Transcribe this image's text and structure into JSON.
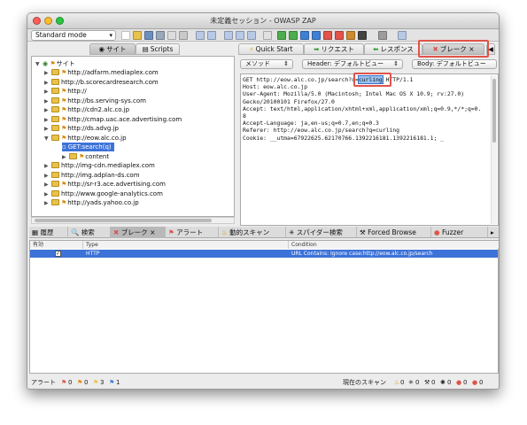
{
  "window": {
    "title": "未定義セッション - OWASP ZAP"
  },
  "toolbar": {
    "mode": "Standard mode"
  },
  "sites_tabs": [
    {
      "label": "サイト",
      "icon": "globe-icon"
    },
    {
      "label": "Scripts",
      "icon": "script-icon"
    }
  ],
  "tree": {
    "root": "サイト",
    "items": [
      {
        "label": "http://adfarm.mediaplex.com",
        "flag": true,
        "expanded": false
      },
      {
        "label": "http://b.scorecardresearch.com",
        "flag": false,
        "expanded": false
      },
      {
        "label": "http://",
        "flag": true,
        "expanded": false
      },
      {
        "label": "http://bs.serving-sys.com",
        "flag": true,
        "expanded": false
      },
      {
        "label": "http://cdn2.alc.co.jp",
        "flag": true,
        "expanded": false
      },
      {
        "label": "http://cmap.uac.ace.advertising.com",
        "flag": true,
        "expanded": false
      },
      {
        "label": "http://ds.advg.jp",
        "flag": true,
        "expanded": false
      },
      {
        "label": "http://eow.alc.co.jp",
        "flag": true,
        "expanded": true
      },
      {
        "label": "GET:search(q)",
        "child": true,
        "selected": true
      },
      {
        "label": "content",
        "child": true,
        "folder": true,
        "flag": true
      },
      {
        "label": "http://img-cdn.mediaplex.com",
        "flag": false,
        "expanded": false
      },
      {
        "label": "http://img.adplan-ds.com",
        "flag": false,
        "expanded": false
      },
      {
        "label": "http://sr-r3.ace.advertising.com",
        "flag": true,
        "expanded": false
      },
      {
        "label": "http://www.google-analytics.com",
        "flag": false,
        "expanded": false
      },
      {
        "label": "http://yads.yahoo.co.jp",
        "flag": true,
        "expanded": false
      }
    ]
  },
  "right_tabs": [
    {
      "label": "Quick Start",
      "icon": "lightning-icon"
    },
    {
      "label": "リクエスト",
      "icon": "arrow-right-icon"
    },
    {
      "label": "レスポンス",
      "icon": "arrow-left-icon"
    },
    {
      "label": "ブレーク",
      "icon": "break-icon",
      "close": "×"
    }
  ],
  "req_controls": {
    "method": "メソッド",
    "header": "Header: デフォルトビュー",
    "body": "Body: デフォルトビュー"
  },
  "request": {
    "line1_pre": "GET http://eow.alc.co.jp/search?q=",
    "line1_hl": "curling",
    "line1_post": " HTTP/1.1",
    "rest": "Host: eow.alc.co.jp\nUser-Agent: Mozilla/5.0 (Macintosh; Intel Mac OS X 10.9; rv:27.0)\nGecko/20100101 Firefox/27.0\nAccept: text/html,application/xhtml+xml,application/xml;q=0.9,*/*;q=0.\n8\nAccept-Language: ja,en-us;q=0.7,en;q=0.3\nReferer: http://eow.alc.co.jp/search?q=curling\nCookie: __utma=67922625.62170766.1392216181.1392216181.1; _"
  },
  "bottom_tabs": [
    {
      "label": "履歴",
      "icon": "history-icon"
    },
    {
      "label": "検索",
      "icon": "search-icon"
    },
    {
      "label": "ブレーク",
      "icon": "break-icon",
      "close": "×"
    },
    {
      "label": "アラート",
      "icon": "alert-flag-icon"
    },
    {
      "label": "動的スキャン",
      "icon": "scan-icon"
    },
    {
      "label": "スパイダー検索",
      "icon": "spider-icon"
    },
    {
      "label": "Forced Browse",
      "icon": "hammer-icon"
    },
    {
      "label": "Fuzzer",
      "icon": "fuzzer-icon"
    }
  ],
  "break_table": {
    "headers": [
      "有効",
      "Type",
      "Condition"
    ],
    "rows": [
      {
        "enabled": true,
        "type": "HTTP",
        "condition": "URL Contains: Ignore case:http://eow.alc.co.jp/search"
      }
    ]
  },
  "status": {
    "alerts_label": "アラート",
    "alert_counts": [
      "0",
      "0",
      "3",
      "1"
    ],
    "scan_label": "現在のスキャン",
    "scan_counts": [
      "0",
      "0",
      "0",
      "0",
      "0",
      "0"
    ]
  },
  "colors": {
    "accent": "#3d72d8",
    "highlight_box": "#e2534a",
    "flag_orange": "#d88a00"
  }
}
